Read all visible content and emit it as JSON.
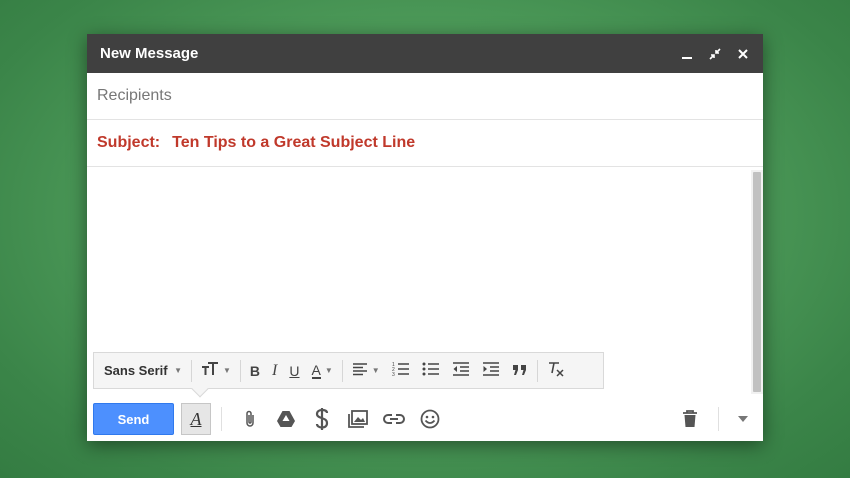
{
  "window": {
    "title": "New Message"
  },
  "recipients": {
    "placeholder": "Recipients"
  },
  "subject": {
    "label": "Subject:",
    "value": "Ten Tips to a Great Subject Line"
  },
  "format_toolbar": {
    "font_family": "Sans Serif",
    "bold_label": "B",
    "italic_label": "I",
    "underline_label": "U",
    "text_color_label": "A"
  },
  "actions": {
    "send_label": "Send",
    "formatting_toggle_label": "A"
  },
  "colors": {
    "titlebar": "#404040",
    "send_button": "#4d90fe",
    "subject_text": "#c0392b",
    "background": "#4f9d5b"
  },
  "icons": [
    "minimize-icon",
    "pop-out-icon",
    "close-icon",
    "attach-icon",
    "drive-icon",
    "money-icon",
    "photo-icon",
    "link-icon",
    "emoji-icon",
    "trash-icon",
    "more-options-icon"
  ]
}
